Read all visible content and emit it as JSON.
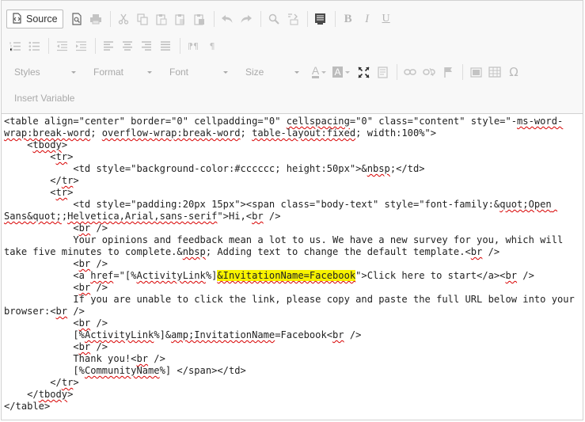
{
  "toolbar": {
    "source_label": "Source",
    "styles_label": "Styles",
    "format_label": "Format",
    "font_label": "Font",
    "size_label": "Size",
    "insert_variable_label": "Insert Variable",
    "bold_glyph": "B",
    "italic_glyph": "I",
    "underline_glyph": "U",
    "font_color_glyph": "A",
    "bg_color_glyph": "A",
    "omega_glyph": "Ω",
    "ltr_glyph": "¶",
    "rtl_glyph": "¶",
    "icons": [
      "preview-icon",
      "print-icon",
      "cut-icon",
      "copy-icon",
      "paste-icon",
      "paste-text-icon",
      "paste-word-icon",
      "undo-icon",
      "redo-icon",
      "find-icon",
      "replace-icon",
      "template-icon",
      "bold-icon",
      "italic-icon",
      "underline-icon",
      "numbered-list-icon",
      "bulleted-list-icon",
      "outdent-icon",
      "indent-icon",
      "align-left-icon",
      "align-center-icon",
      "align-right-icon",
      "justify-icon",
      "ltr-icon",
      "rtl-icon",
      "text-color-icon",
      "bg-color-icon",
      "maximize-icon",
      "show-blocks-icon",
      "link-icon",
      "unlink-icon",
      "anchor-icon",
      "image-icon",
      "table-icon",
      "special-char-icon"
    ]
  },
  "code": {
    "l1a": "<table align=\"center\" border=\"0\" cellpadding=\"0\" ",
    "l1b": "cellspacing",
    "l1c": "=\"0\" class=\"content\" style=\"-",
    "l1d": "ms-word-wrap:break-word",
    "l1e": "; ",
    "l1f": "overflow-wrap:break-word",
    "l1g": "; ",
    "l1h": "table-layout:fixed",
    "l1i": "; width:100%\">\n    <",
    "l1j": "tbody",
    "l1k": ">\n        <",
    "l1l": "tr",
    "l1m": ">\n            <td style=\"background-color:#cccccc; height:50px\">&",
    "l1n": "nbsp",
    "l1o": ";</td>\n        </",
    "l1p": "tr",
    "l1q": ">\n        <",
    "l1r": "tr",
    "l1s": ">\n            <td style=\"padding:20px 15px\"><span class=\"body-text\" style=\"font-family:&",
    "l1t": "quot;Open Sans&quot;",
    "l1u": ";",
    "l1v": "Helvetica,Arial,sans-serif",
    "l1w": "\">Hi,<",
    "l1x": "br",
    "l1y": " />\n            <",
    "l1z": "br",
    "m1": " />\n            Your opinions and feedback mean a lot to us. We have a new survey for you, which will take five minutes to complete.&",
    "m2": "nbsp",
    "m3": "; Adding text to change the default template.<",
    "m4": "br",
    "m5": " />\n            <",
    "m6": "br",
    "m7": " />\n            <a ",
    "m8": "href",
    "m9": "=\"[%",
    "m10": "ActivityLink",
    "m11": "%]",
    "m12": "&InvitationName=Facebook",
    "m13": "\">Click here to start</a><",
    "m14": "br",
    "m15": " />\n            <",
    "m16": "br",
    "m17": " />\n            If you are unable to click the link, please copy and paste the full URL below into your browser:<",
    "m18": "br",
    "m19": " />\n            <",
    "m20": "br",
    "m21": " />\n            [%",
    "m22": "ActivityLink",
    "m23": "%]&",
    "m24": "amp;InvitationName",
    "m25": "=Facebook<",
    "m26": "br",
    "m27": " />\n            <",
    "m28": "br",
    "m29": " />\n            Thank you!<",
    "m30": "br",
    "m31": " />\n            [%",
    "m32": "CommunityName",
    "m33": "%] </span></td>\n        </",
    "m34": "tr",
    "m35": ">\n    </",
    "m36": "tbody",
    "m37": ">\n</table>"
  }
}
